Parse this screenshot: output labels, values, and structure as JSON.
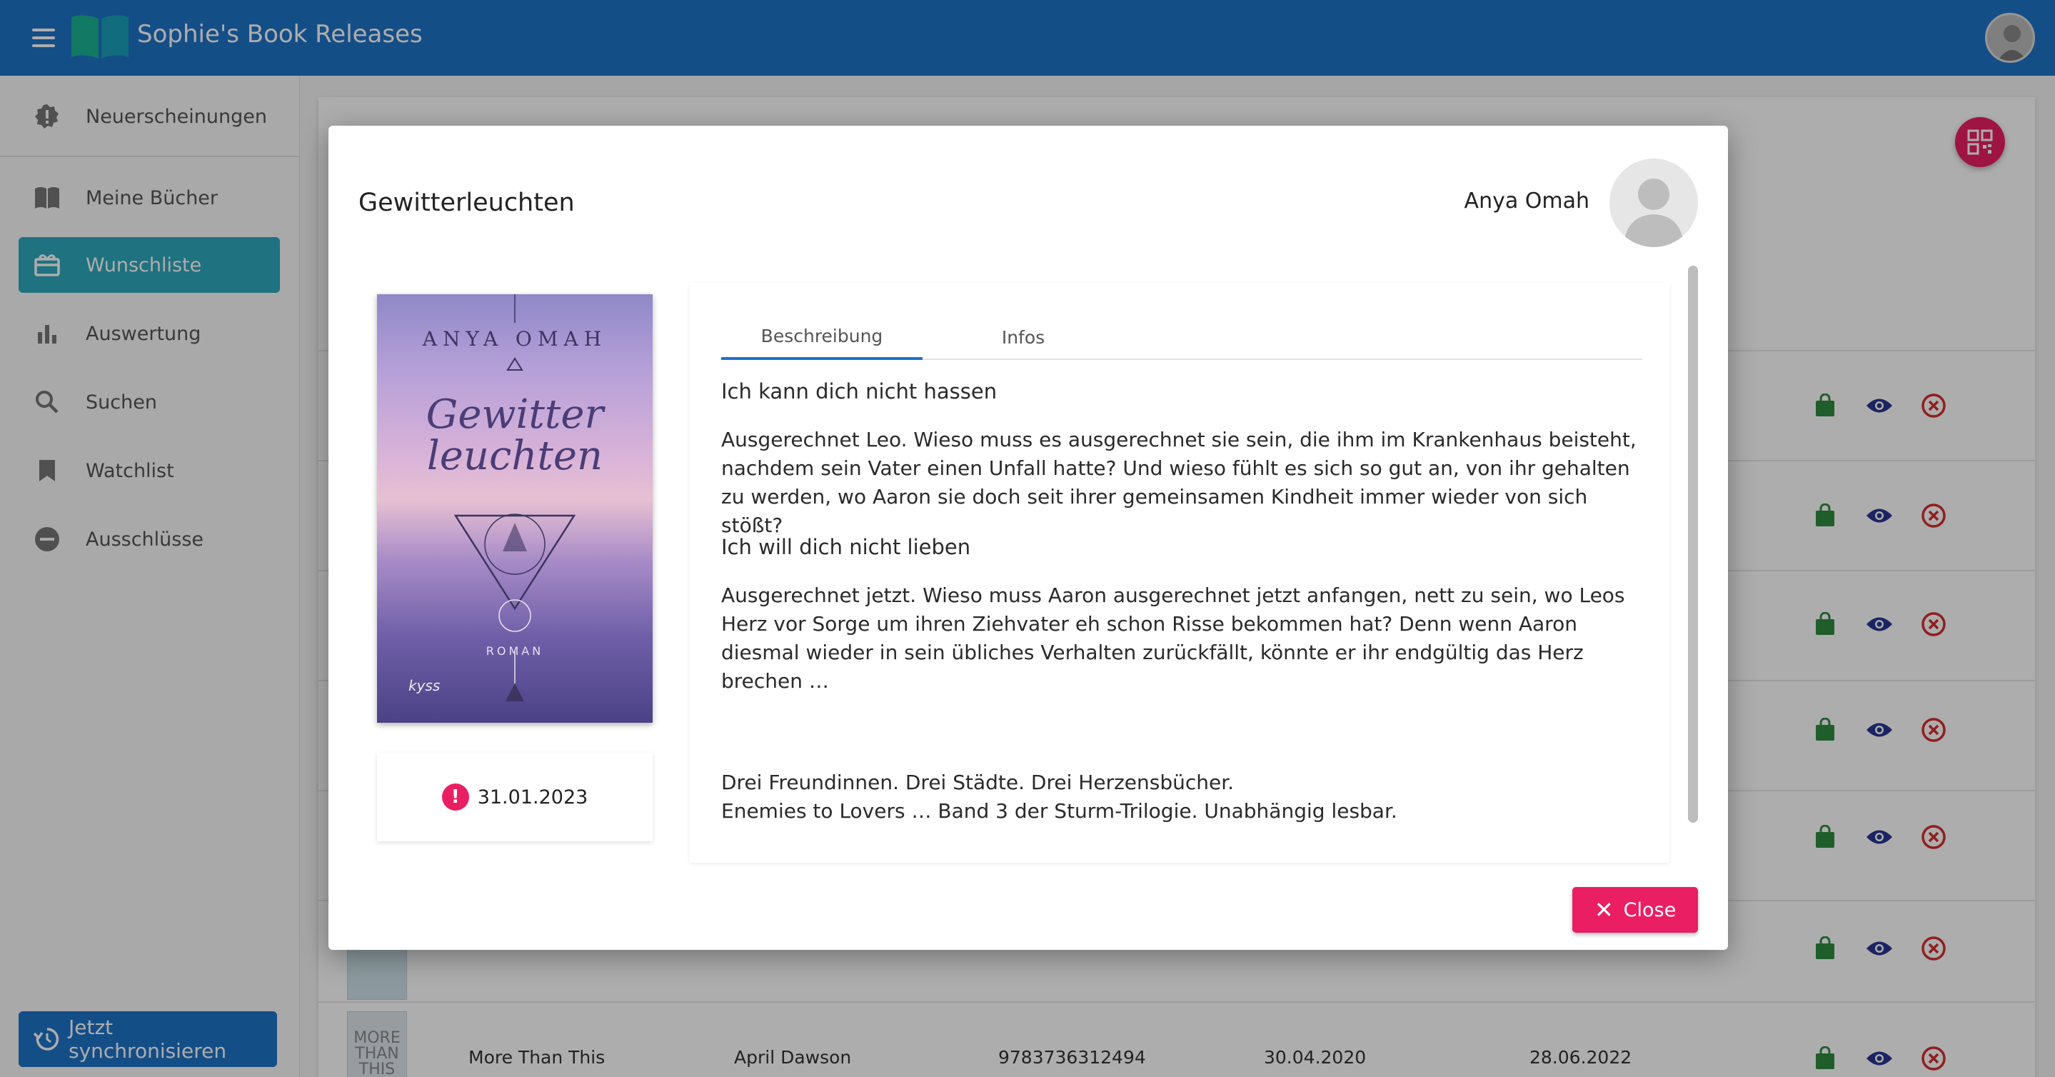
{
  "app": {
    "title": "Sophie's Book Releases"
  },
  "sidebar": {
    "items": [
      {
        "label": "Neuerscheinungen",
        "icon": "badge-alert-icon"
      },
      {
        "label": "Meine Bücher",
        "icon": "book-open-icon"
      },
      {
        "label": "Wunschliste",
        "icon": "gift-icon",
        "active": true
      },
      {
        "label": "Auswertung",
        "icon": "bar-chart-icon"
      },
      {
        "label": "Suchen",
        "icon": "search-icon"
      },
      {
        "label": "Watchlist",
        "icon": "bookmark-icon"
      },
      {
        "label": "Ausschlüsse",
        "icon": "minus-circle-icon"
      }
    ],
    "sync_label": "Jetzt synchronisieren"
  },
  "table": {
    "last_row": {
      "title": "More Than This",
      "author": "April Dawson",
      "isbn": "9783736312494",
      "release": "30.04.2020",
      "added": "28.06.2022",
      "cover_text": "MORE THAN THIS"
    }
  },
  "dialog": {
    "title": "Gewitterleuchten",
    "author": "Anya Omah",
    "cover": {
      "author": "ANYA OMAH",
      "title_line1": "Gewitter",
      "title_line2": "leuchten",
      "genre": "ROMAN",
      "publisher": "kyss"
    },
    "date": "31.01.2023",
    "tabs": [
      "Beschreibung",
      "Infos"
    ],
    "description": {
      "heading1": "Ich kann dich nicht hassen",
      "para1": "Ausgerechnet Leo. Wieso muss es ausgerechnet sie sein, die ihm im Krankenhaus beisteht, nachdem sein Vater einen Unfall hatte? Und wieso fühlt es sich so gut an, von ihr gehalten zu werden, wo Aaron sie doch seit ihrer gemeinsamen Kindheit immer wieder von sich stößt?",
      "heading2": "Ich will dich nicht lieben",
      "para2": "Ausgerechnet jetzt. Wieso muss Aaron ausgerechnet jetzt anfangen, nett zu sein, wo Leos Herz vor Sorge um ihren Ziehvater eh schon Risse bekommen hat? Denn wenn Aaron diesmal wieder in sein übliches Verhalten zurückfällt, könnte er ihr endgültig das Herz brechen …",
      "tagline1": "Drei Freundinnen. Drei Städte. Drei Herzensbücher.",
      "tagline2": "Enemies to Lovers … Band 3 der Sturm-Trilogie. Unabhängig lesbar."
    },
    "close_label": "Close"
  },
  "colors": {
    "primary": "#1e73c8",
    "accent": "#e91e63",
    "active_nav": "#2fa9bb",
    "shop_green": "#2e8b3e",
    "eye_blue": "#283593",
    "remove_red": "#d32f2f"
  }
}
